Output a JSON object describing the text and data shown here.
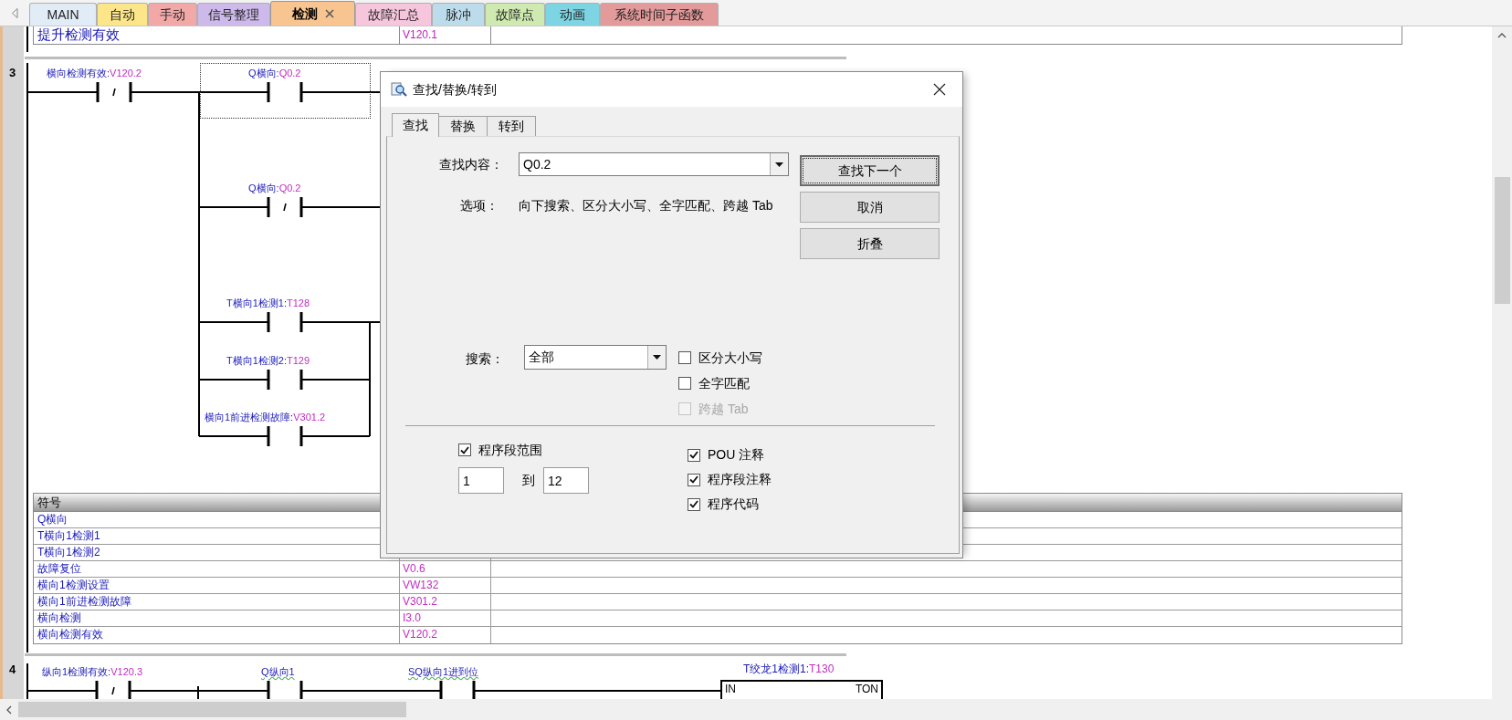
{
  "tab_bar": {
    "tabs": [
      {
        "label": "MAIN",
        "selected": false,
        "color": "#e2ecf7"
      },
      {
        "label": "自动",
        "selected": false,
        "color": "#fde68a"
      },
      {
        "label": "手动",
        "selected": false,
        "color": "#f3a8a8"
      },
      {
        "label": "信号整理",
        "selected": false,
        "color": "#cdb9ea"
      },
      {
        "label": "检测",
        "selected": true,
        "color": "#f8c48f"
      },
      {
        "label": "故障汇总",
        "selected": false,
        "color": "#f6c6dc"
      },
      {
        "label": "脉冲",
        "selected": false,
        "color": "#bcdcec"
      },
      {
        "label": "故障点",
        "selected": false,
        "color": "#cfeab0"
      },
      {
        "label": "动画",
        "selected": false,
        "color": "#7dd4e2"
      },
      {
        "label": "系统时间子函数",
        "selected": false,
        "color": "#e39a9a"
      }
    ]
  },
  "editor": {
    "network_2": {
      "symbol_row": {
        "symbol": "提升检测有效",
        "address": "V120.1"
      }
    },
    "network_3": {
      "number": "3",
      "contacts": [
        {
          "symbol": "横向检测有效:",
          "address": "V120.2",
          "kind": "nc",
          "selected": false,
          "flagged": false
        },
        {
          "symbol": "Q横向:",
          "address": "Q0.2",
          "kind": "no",
          "selected": true,
          "flagged": false
        },
        {
          "symbol": "Q横向:",
          "address": "Q0.2",
          "kind": "nc",
          "selected": false,
          "flagged": false
        },
        {
          "symbol": "T横向1检测1:",
          "address": "T128",
          "kind": "no",
          "selected": false,
          "flagged": false
        },
        {
          "symbol": "T横向1检测2:",
          "address": "T129",
          "kind": "no",
          "selected": false,
          "flagged": false
        },
        {
          "symbol": "横向1前进检测故障:",
          "address": "V301.2",
          "kind": "no",
          "selected": false,
          "flagged": false
        }
      ],
      "symbol_table": {
        "header": "符号",
        "rows": [
          {
            "symbol": "Q横向"
          },
          {
            "symbol": "T横向1检测1"
          },
          {
            "symbol": "T横向1检测2"
          },
          {
            "symbol": "故障复位",
            "address": "V0.6"
          },
          {
            "symbol": "横向1检测设置",
            "address": "VW132"
          },
          {
            "symbol": "横向1前进检测故障",
            "address": "V301.2"
          },
          {
            "symbol": "横向检测",
            "address": "I3.0"
          },
          {
            "symbol": "横向检测有效",
            "address": "V120.2"
          }
        ]
      }
    },
    "network_4": {
      "number": "4",
      "contacts": [
        {
          "symbol": "纵向1检测有效:",
          "address": "V120.3",
          "kind": "nc",
          "selected": false,
          "flagged": false
        },
        {
          "symbol": "Q纵向1",
          "kind": "no",
          "selected": false,
          "flagged": true
        },
        {
          "symbol": "SQ纵向1进到位",
          "kind": "no",
          "selected": false,
          "flagged": true
        }
      ],
      "box": {
        "symbol": "T绞龙1检测1:",
        "address": "T130",
        "input": "IN",
        "type": "TON"
      }
    }
  },
  "dialog": {
    "title": "查找/替换/转到",
    "tabs": [
      {
        "label": "查找",
        "selected": true
      },
      {
        "label": "替换",
        "selected": false
      },
      {
        "label": "转到",
        "selected": false
      }
    ],
    "find": {
      "label": "查找内容：",
      "value": "Q0.2"
    },
    "options": {
      "label": "选项：",
      "text": "向下搜索、区分大小写、全字匹配、跨越 Tab"
    },
    "search": {
      "label": "搜索：",
      "value": "全部"
    },
    "match_options": [
      {
        "label": "区分大小写",
        "checked": false,
        "disabled": false
      },
      {
        "label": "全字匹配",
        "checked": false,
        "disabled": false
      },
      {
        "label": "跨越 Tab",
        "checked": false,
        "disabled": true
      }
    ],
    "range": {
      "label": "程序段范围",
      "checked": true,
      "from": "1",
      "to_label": "到",
      "to": "12"
    },
    "scope": [
      {
        "label": "POU 注释",
        "checked": true
      },
      {
        "label": "程序段注释",
        "checked": true
      },
      {
        "label": "程序代码",
        "checked": true
      }
    ],
    "buttons": [
      {
        "label": "查找下一个",
        "default": true
      },
      {
        "label": "取消",
        "default": false
      },
      {
        "label": "折叠",
        "default": false
      }
    ]
  }
}
